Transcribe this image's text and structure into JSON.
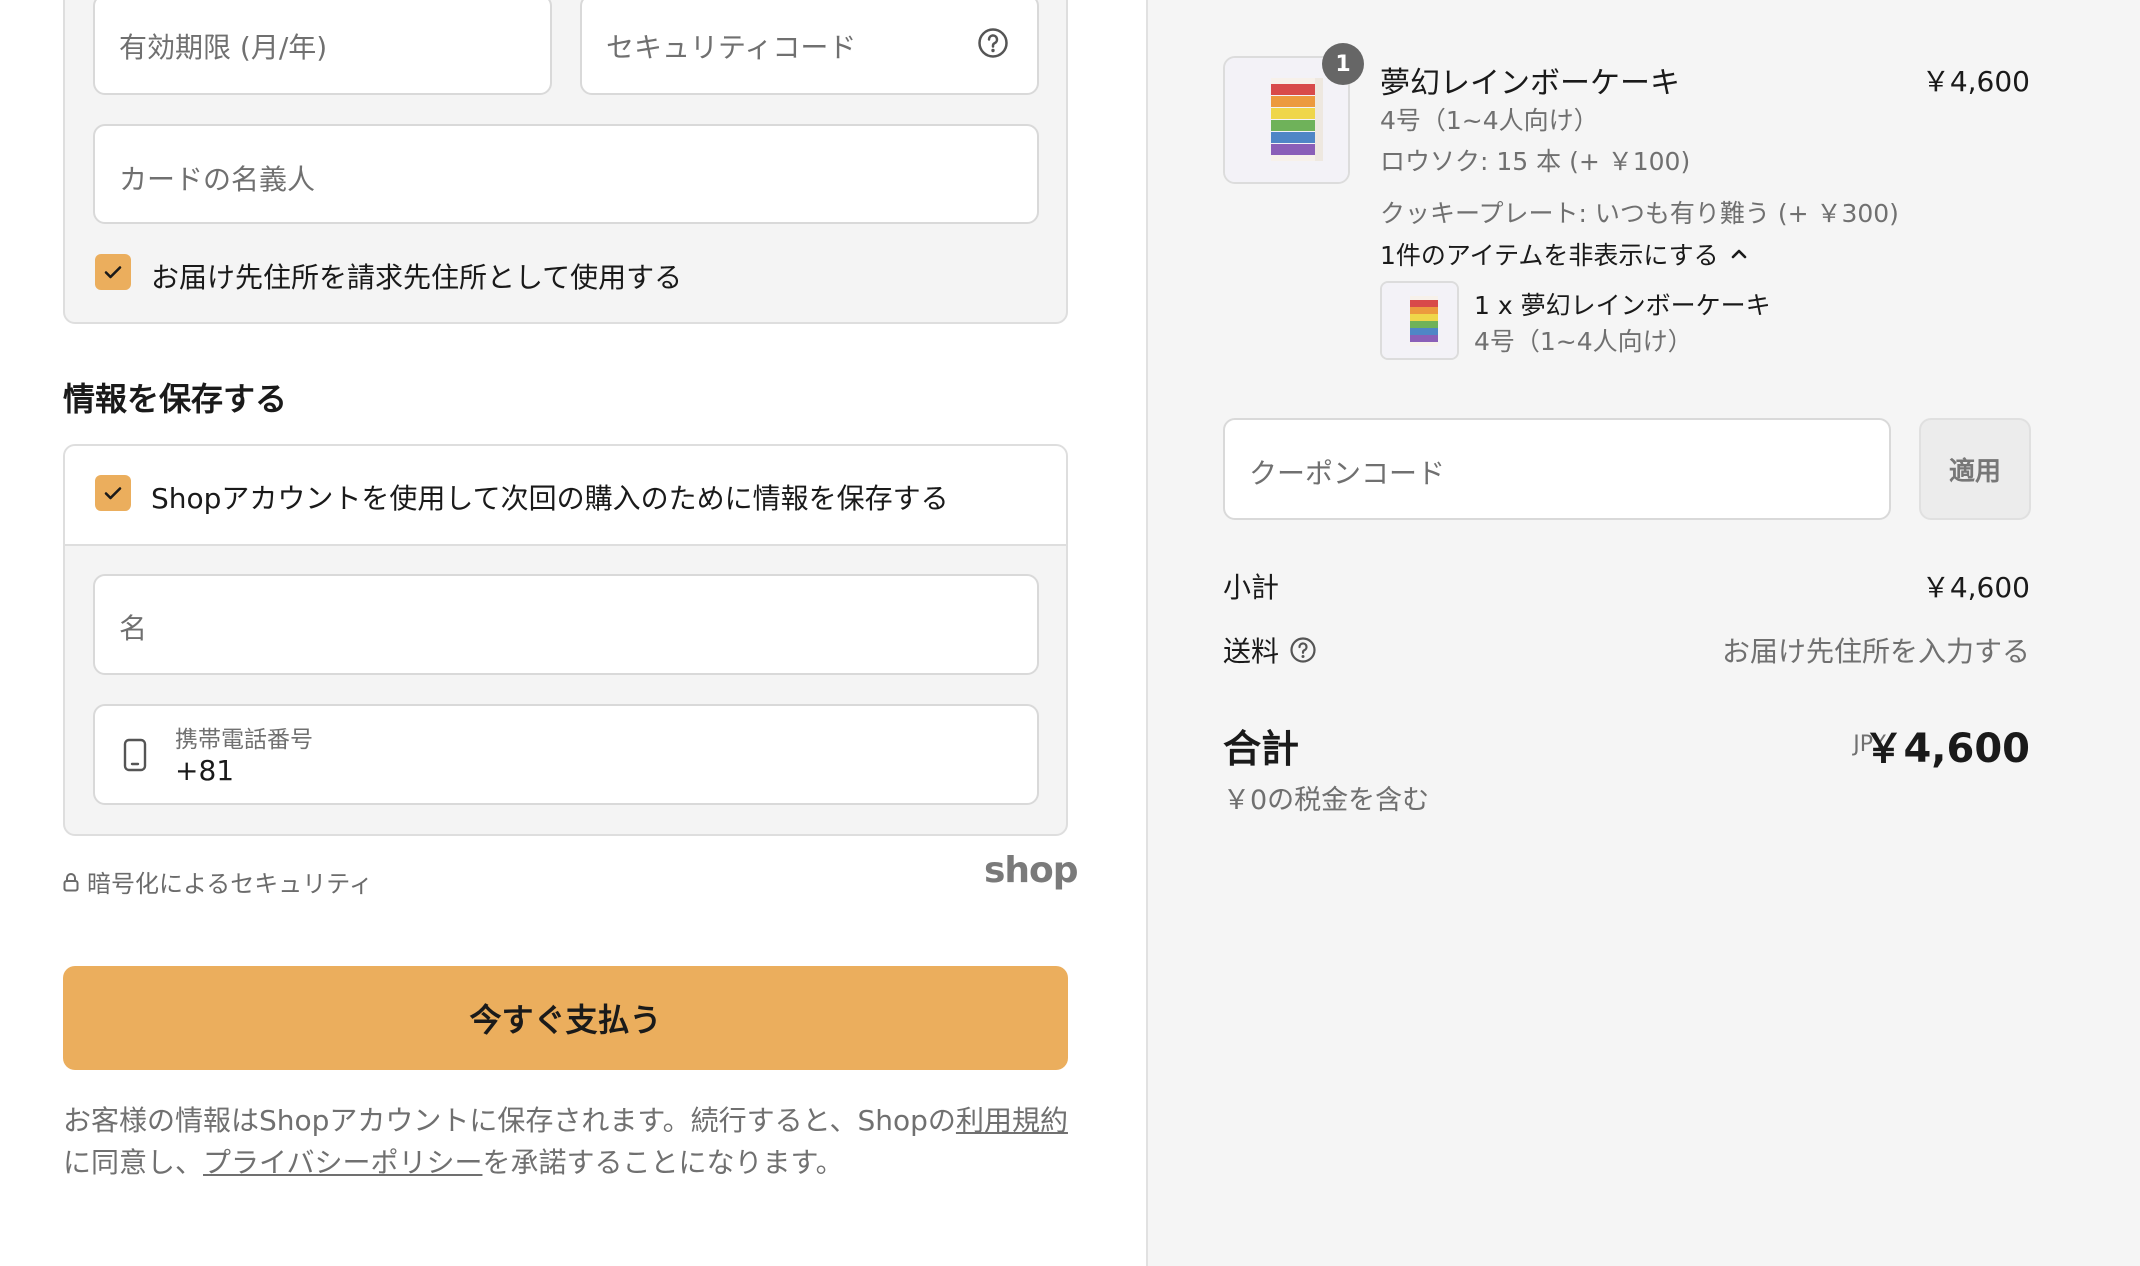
{
  "payment": {
    "expiry_placeholder": "有効期限 (月/年)",
    "security_placeholder": "セキュリティコード",
    "cardholder_placeholder": "カードの名義人",
    "use_shipping_as_billing": "お届け先住所を請求先住所として使用する"
  },
  "save_info": {
    "title": "情報を保存する",
    "shop_account_checkbox": "Shopアカウントを使用して次回の購入のために情報を保存する",
    "name_placeholder": "名",
    "phone_label": "携帯電話番号",
    "phone_value": "+81"
  },
  "security_note": "暗号化によるセキュリティ",
  "shop_logo_text": "shop",
  "pay_button": "今すぐ支払う",
  "terms": {
    "prefix": "お客様の情報はShopアカウントに保存されます。続行すると、Shopの",
    "terms_link": "利用規約",
    "middle": "に同意し、",
    "privacy_link": "プライバシーポリシー",
    "suffix": "を承諾することになります。"
  },
  "order": {
    "quantity_badge": "1",
    "item_name": "夢幻レインボーケーキ",
    "item_price": "￥4,600",
    "item_size": "4号（1~4人向け）",
    "item_candles": "ロウソク: 15 本 (+ ￥100)",
    "item_plate": "クッキープレート: いつも有り難う (+ ￥300)",
    "toggle_label": "1件のアイテムを非表示にする",
    "sub_item_name": "1 x 夢幻レインボーケーキ",
    "sub_item_size": "4号（1~4人向け）"
  },
  "coupon": {
    "placeholder": "クーポンコード",
    "apply_label": "適用"
  },
  "summary": {
    "subtotal_label": "小計",
    "subtotal_value": "￥4,600",
    "shipping_label": "送料",
    "shipping_value": "お届け先住所を入力する",
    "total_label": "合計",
    "currency": "JPY",
    "total_value": "￥4,600",
    "tax_note": "￥0の税金を含む"
  },
  "colors": {
    "accent": "#ebae5d",
    "panel_bg": "#f5f5f5"
  }
}
